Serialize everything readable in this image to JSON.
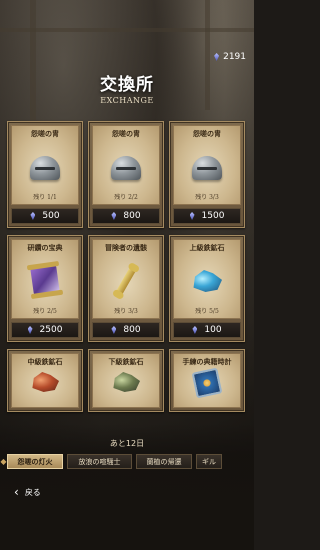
{
  "header": {
    "currency_amount": "2191",
    "title": "交換所",
    "subtitle": "EXCHANGE"
  },
  "items": [
    {
      "name": "怨嗟の冑",
      "stock": "残り 1/1",
      "price": "500",
      "icon": "iron-helmet-icon"
    },
    {
      "name": "怨嗟の冑",
      "stock": "残り 2/2",
      "price": "800",
      "icon": "iron-helmet-icon"
    },
    {
      "name": "怨嗟の冑",
      "stock": "残り 3/3",
      "price": "1500",
      "icon": "iron-helmet-icon"
    },
    {
      "name": "研鑽の宝典",
      "stock": "残り 2/5",
      "price": "2500",
      "icon": "purple-scroll-icon"
    },
    {
      "name": "冒険者の遺骸",
      "stock": "残り 3/3",
      "price": "800",
      "icon": "golden-bone-icon"
    },
    {
      "name": "上級鉄鉱石",
      "stock": "残り 5/5",
      "price": "100",
      "icon": "blue-ore-icon"
    },
    {
      "name": "中級鉄鉱石",
      "icon": "red-ore-icon"
    },
    {
      "name": "下級鉄鉱石",
      "icon": "green-ore-icon"
    },
    {
      "name": "手練の典籍時計",
      "icon": "blue-tome-icon"
    }
  ],
  "footer": {
    "remaining": "あと12日",
    "tabs": [
      {
        "label": "怨嗟の灯火",
        "active": true
      },
      {
        "label": "放浪の喧騒士",
        "active": false
      },
      {
        "label": "蘭植の帰還",
        "active": false
      },
      {
        "label": "ギル",
        "active": false
      }
    ],
    "back_label": "戻る"
  },
  "colors": {
    "card_frame": "#7e6a4d",
    "card_inner": "#e5d7b7",
    "price_bar": "#2e2722",
    "active_tab": "#d2b887"
  }
}
